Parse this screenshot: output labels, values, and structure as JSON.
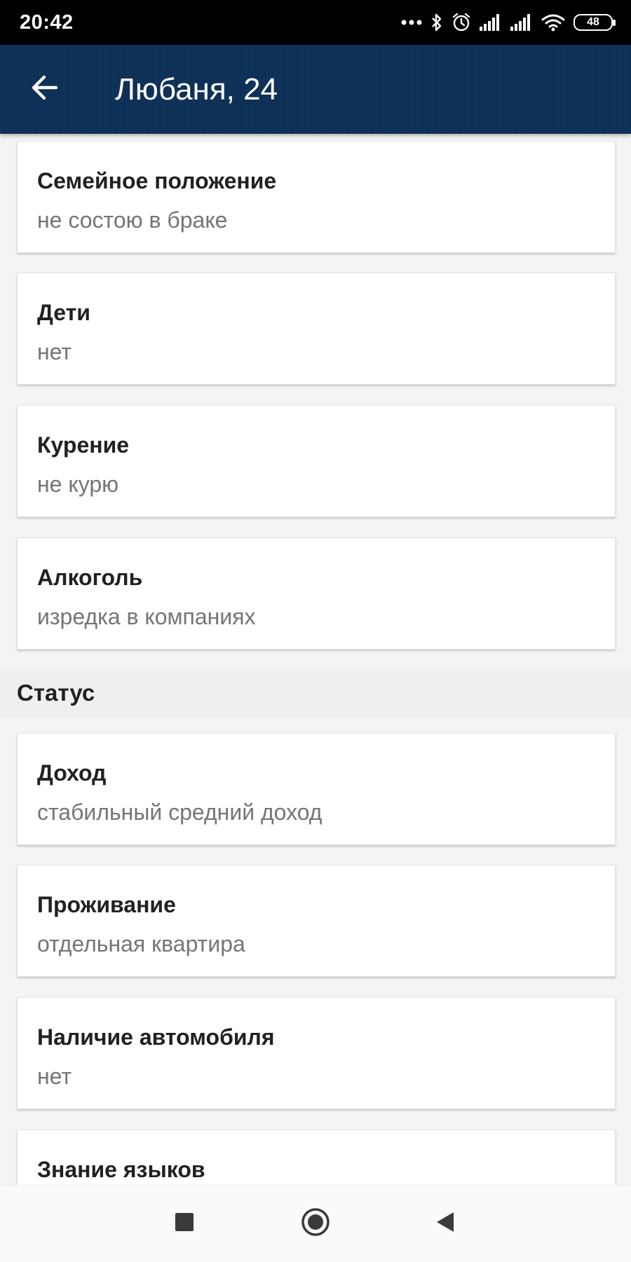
{
  "status_bar": {
    "time": "20:42",
    "battery": "48",
    "icons": [
      "more-dots-icon",
      "bluetooth-icon",
      "alarm-icon",
      "signal-icon",
      "signal-icon",
      "wifi-icon",
      "battery-icon"
    ]
  },
  "app_bar": {
    "title": "Любаня, 24",
    "background_color": "#0d3057"
  },
  "cards": [
    {
      "label": "Семейное положение",
      "value": "не состою в браке"
    },
    {
      "label": "Дети",
      "value": "нет"
    },
    {
      "label": "Курение",
      "value": "не курю"
    },
    {
      "label": "Алкоголь",
      "value": "изредка в компаниях"
    },
    {
      "label": "Доход",
      "value": "стабильный средний доход"
    },
    {
      "label": "Проживание",
      "value": "отдельная квартира"
    },
    {
      "label": "Наличие автомобиля",
      "value": "нет"
    },
    {
      "label": "Знание языков"
    }
  ],
  "sections": {
    "status_title": "Статус"
  },
  "nav_bar": {
    "buttons": [
      "recent-apps-icon",
      "home-icon",
      "back-triangle-icon"
    ]
  }
}
